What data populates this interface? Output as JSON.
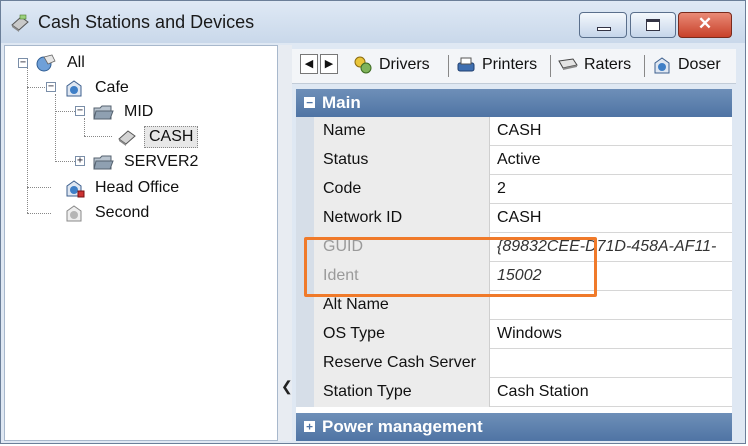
{
  "window": {
    "title": "Cash Stations and Devices",
    "close_glyph": "✕"
  },
  "tree": {
    "items": [
      {
        "label": "All",
        "icon": "network-globe-icon"
      },
      {
        "label": "Cafe",
        "icon": "site-icon"
      },
      {
        "label": "MID",
        "icon": "folder-icon"
      },
      {
        "label": "CASH",
        "icon": "cash-station-icon",
        "selected": true
      },
      {
        "label": "SERVER2",
        "icon": "folder-icon"
      },
      {
        "label": "Head Office",
        "icon": "site-icon"
      },
      {
        "label": "Second",
        "icon": "site-icon"
      }
    ]
  },
  "toolbar": {
    "items": [
      {
        "label": "Drivers",
        "icon": "drivers-icon"
      },
      {
        "label": "Printers",
        "icon": "printer-icon"
      },
      {
        "label": "Raters",
        "icon": "rater-icon"
      },
      {
        "label": "Doser",
        "icon": "doser-icon"
      }
    ]
  },
  "grid": {
    "main_section": "Main",
    "power_section": "Power management",
    "rows": [
      {
        "name": "Name",
        "value": "CASH"
      },
      {
        "name": "Status",
        "value": "Active"
      },
      {
        "name": "Code",
        "value": "2"
      },
      {
        "name": "Network ID",
        "value": "CASH"
      },
      {
        "name": "GUID",
        "value": "{89832CEE-D71D-458A-AF11-",
        "disabled": true,
        "italic": true
      },
      {
        "name": "Ident",
        "value": "15002",
        "disabled": true,
        "italic": true
      },
      {
        "name": "Alt Name",
        "value": ""
      },
      {
        "name": "OS Type",
        "value": "Windows"
      },
      {
        "name": "Reserve Cash Server",
        "value": ""
      },
      {
        "name": "Station Type",
        "value": "Cash Station"
      }
    ]
  },
  "colors": {
    "section": "#4f74a4",
    "highlight": "#f07a2a"
  }
}
